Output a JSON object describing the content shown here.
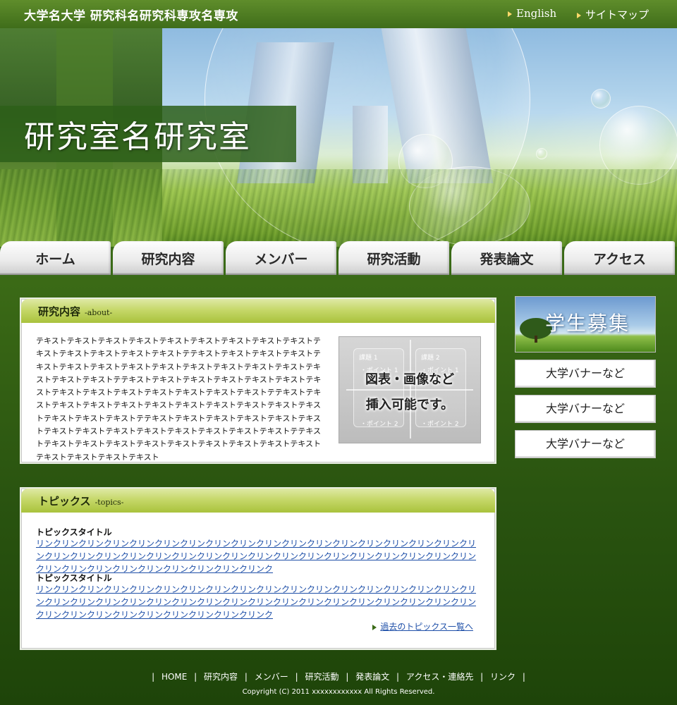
{
  "header": {
    "site_title": "大学名大学 研究科名研究科専攻名専攻",
    "links": {
      "english": "English",
      "sitemap": "サイトマップ"
    }
  },
  "hero": {
    "lab_title": "研究室名研究室"
  },
  "nav": {
    "tabs": [
      "ホーム",
      "研究内容",
      "メンバー",
      "研究活動",
      "発表論文",
      "アクセス"
    ]
  },
  "about": {
    "title": "研究内容",
    "subtitle": "-about-",
    "body": "テキストテキストテキストテキストテキストテキストテキストテキストテキストテキストテキストテキストテキストテキストテテキストテキストテキストテキストテキストテキストテキストテキストテキストテキストテキストテキストテキストテキストテキストテキストテテキストテキストテキストテキストテキストテキストテキストテキストテキストテキストテキストテキストテキストテキストテテキストテキストテキストテキストテキストテキストテキストテキストテキストテキストテキストテキストテキストテキストテテキストテキストテキストテキストテキストテキストテキストテキストテキストテキストテキストテキストテキストテキストテテキストテキストテキストテキストテキストテキストテキストテキストテキストテキストテキストテキストテキストテキスト",
    "figure": {
      "line1": "図表・画像など",
      "line2": "挿入可能です。",
      "labels": {
        "box1": "課題 1",
        "box2": "課題 2",
        "point1": "・ポイント 1",
        "point2": "・ポイント 2"
      }
    }
  },
  "topics": {
    "title": "トピックス",
    "subtitle": "-topics-",
    "items": [
      {
        "title": "トピックスタイトル",
        "link": "リンクリンクリンクリンクリンクリンクリンクリンクリンクリンクリンクリンクリンクリンクリンクリンクリンクリンクリンクリンクリンクリンクリンクリンクリンクリンクリンクリンクリンクリンクリンクリンクリンクリンクリンクリンクリンクリンクリンクリンクリンクリンクリンクリンク"
      },
      {
        "title": "トピックスタイトル",
        "link": "リンクリンクリンクリンクリンクリンクリンクリンクリンクリンクリンクリンクリンクリンクリンクリンクリンクリンクリンクリンクリンクリンクリンクリンクリンクリンクリンクリンクリンクリンクリンクリンクリンクリンクリンクリンクリンクリンクリンクリンクリンクリンクリンクリンク"
      }
    ],
    "past_link": "過去のトピックス一覧へ"
  },
  "sidebar": {
    "recruit_label": "学生募集",
    "banners": [
      "大学バナーなど",
      "大学バナーなど",
      "大学バナーなど"
    ]
  },
  "footer": {
    "links": [
      "HOME",
      "研究内容",
      "メンバー",
      "研究活動",
      "発表論文",
      "アクセス・連絡先",
      "リンク"
    ],
    "separator": "|",
    "copyright": "Copyright (C) 2011 xxxxxxxxxxxx All Rights Reserved."
  },
  "colors": {
    "background_green": "#2f5a12",
    "panel_header_green": "#c6d86a",
    "link_blue": "#1e4fa8",
    "tab_gray": "#ebebeb"
  }
}
